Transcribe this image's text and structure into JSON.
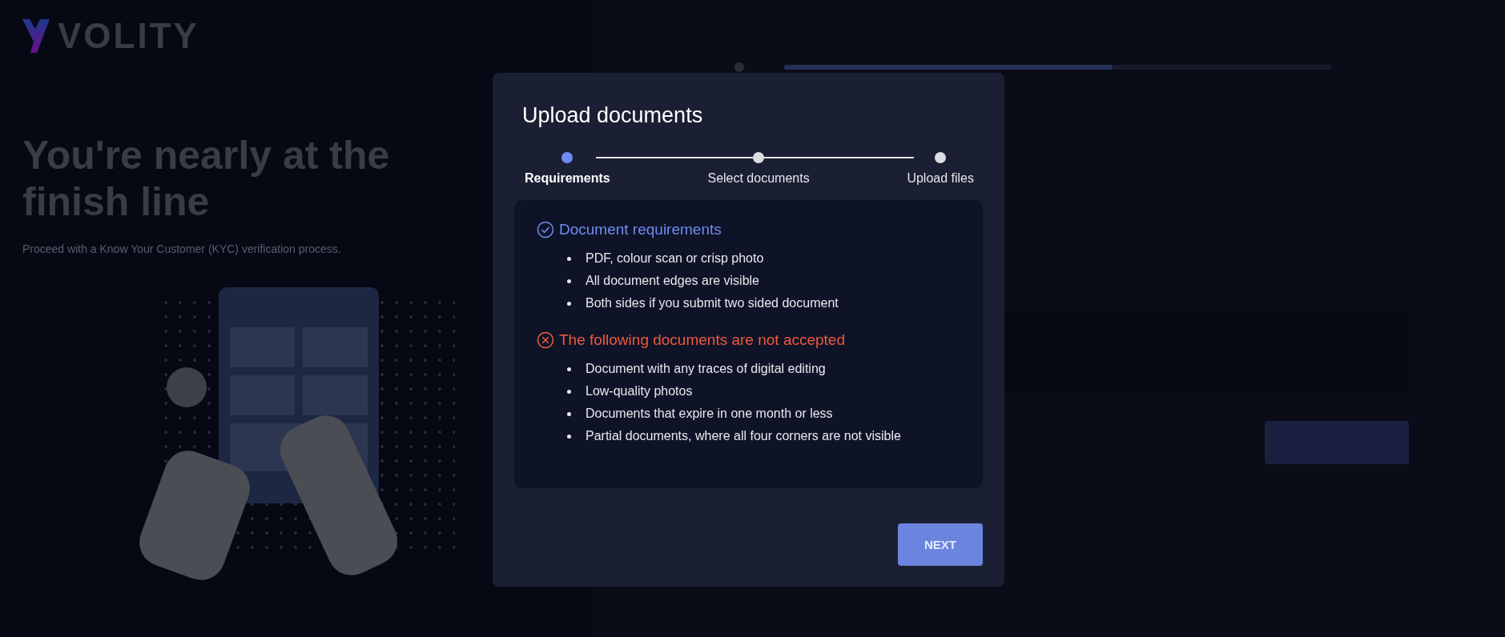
{
  "background": {
    "logo": "VOLITY",
    "heading": "You're nearly at the finish line",
    "subtitle": "Proceed with a Know Your Customer (KYC) verification process.",
    "progress": {
      "level": 0.6
    }
  },
  "dialog": {
    "title": "Upload documents",
    "steps": [
      {
        "label": "Requirements",
        "selected": true
      },
      {
        "label": "Select documents",
        "selected": false
      },
      {
        "label": "Upload files",
        "selected": false
      }
    ],
    "sections": [
      {
        "kind": "accepted",
        "title": "Document requirements",
        "items": [
          "PDF, colour scan or crisp photo",
          "All document edges are visible",
          "Both sides if you submit two sided document"
        ]
      },
      {
        "kind": "rejected",
        "title": "The following documents are not accepted",
        "items": [
          "Document with any traces of digital editing",
          "Low-quality photos",
          "Documents that expire in one month or less",
          "Partial documents, where all four corners are not visible"
        ]
      }
    ],
    "next_button": "NEXT"
  }
}
